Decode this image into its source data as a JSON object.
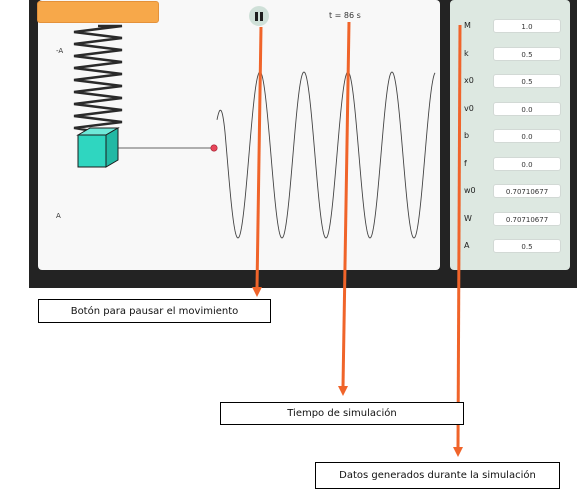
{
  "simulation": {
    "time_label": "t = 86 s",
    "label_neg_a": "-A",
    "label_a": "A",
    "pause_icon": "pause-icon"
  },
  "params": [
    {
      "label": "M",
      "value": "1.0"
    },
    {
      "label": "k",
      "value": "0.5"
    },
    {
      "label": "x0",
      "value": "0.5"
    },
    {
      "label": "v0",
      "value": "0.0"
    },
    {
      "label": "b",
      "value": "0.0"
    },
    {
      "label": "f",
      "value": "0.0"
    },
    {
      "label": "w0",
      "value": "0.70710677"
    },
    {
      "label": "W",
      "value": "0.70710677"
    },
    {
      "label": "A",
      "value": "0.5"
    }
  ],
  "annotations": {
    "pause_callout": "Botón para pausar el movimiento",
    "time_callout": "Tiempo de simulación",
    "data_callout": "Datos generados durante la simulación"
  },
  "colors": {
    "arrow": "#f0642a",
    "mass": "#2fd6c0",
    "marker": "#e8465a",
    "panel": "#dde8e1",
    "header_bar": "#f7a84a"
  }
}
